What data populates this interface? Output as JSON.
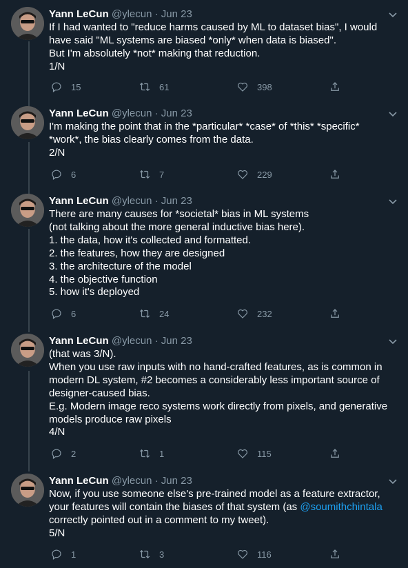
{
  "tweets": [
    {
      "name": "Yann LeCun",
      "handle": "@ylecun",
      "sep": "·",
      "date": "Jun 23",
      "lines": [
        "If I had wanted to \"reduce harms caused by ML to dataset bias\", I would",
        "have said \"ML systems are biased *only* when data is biased\".",
        "But I'm absolutely *not* making that reduction.",
        "1/N"
      ],
      "replies": "15",
      "retweets": "61",
      "likes": "398"
    },
    {
      "name": "Yann LeCun",
      "handle": "@ylecun",
      "sep": "·",
      "date": "Jun 23",
      "lines": [
        "I'm making the point that in the *particular* *case* of *this* *specific*",
        "*work*, the bias clearly comes from the data.",
        "2/N"
      ],
      "replies": "6",
      "retweets": "7",
      "likes": "229"
    },
    {
      "name": "Yann LeCun",
      "handle": "@ylecun",
      "sep": "·",
      "date": "Jun 23",
      "lines": [
        "There are many causes for *societal* bias in ML systems",
        "(not talking about the more general inductive bias here).",
        "1. the data, how it's collected and formatted.",
        "2. the features, how they are designed",
        "3. the architecture of the model",
        "4. the objective function",
        "5. how it's deployed"
      ],
      "replies": "6",
      "retweets": "24",
      "likes": "232"
    },
    {
      "name": "Yann LeCun",
      "handle": "@ylecun",
      "sep": "·",
      "date": "Jun 23",
      "lines": [
        "(that was 3/N).",
        "When you use raw inputs with no hand-crafted features, as is common in",
        "modern DL system, #2 becomes a considerably less important source of",
        "designer-caused bias.",
        "E.g. Modern image reco systems work directly from pixels, and generative",
        "models produce raw pixels",
        "4/N"
      ],
      "replies": "2",
      "retweets": "1",
      "likes": "115"
    },
    {
      "name": "Yann LeCun",
      "handle": "@ylecun",
      "sep": "·",
      "date": "Jun 23",
      "lines": [
        "Now, if you use someone else's pre-trained model as a feature extractor,",
        "your features will contain the biases of that system (as ",
        "correctly pointed out in a comment to my tweet).",
        "5/N"
      ],
      "mention": "@soumithchintala",
      "line2_after": "",
      "replies": "1",
      "retweets": "3",
      "likes": "116"
    }
  ],
  "colors": {
    "background": "#15202b",
    "text": "#ffffff",
    "muted": "#8899a6",
    "link": "#1da1f2",
    "thread_line": "#38444d"
  },
  "icons": {
    "reply": "speech-bubble-icon",
    "retweet": "retweet-icon",
    "like": "heart-icon",
    "share": "share-icon",
    "more": "chevron-down-icon"
  }
}
